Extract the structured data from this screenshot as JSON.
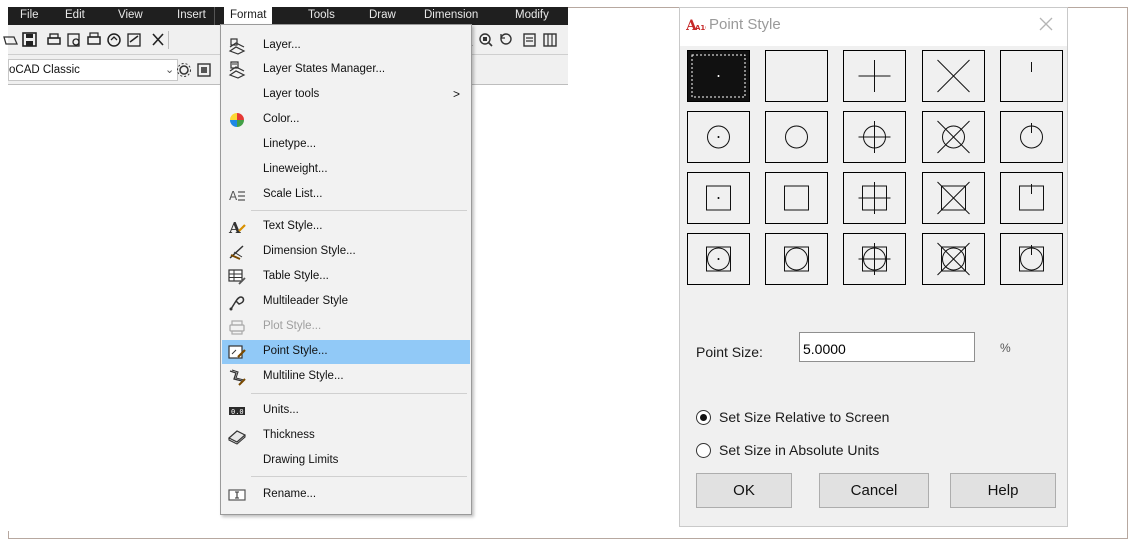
{
  "menubar": {
    "items": [
      "File",
      "Edit",
      "View",
      "Insert",
      "Format",
      "Tools",
      "Draw",
      "Dimension",
      "Modify"
    ],
    "active": "Format"
  },
  "toolbar": {
    "workspace_value": "oCAD Classic"
  },
  "format_menu": {
    "items": [
      {
        "label": "Layer...",
        "icon": "layer-icon"
      },
      {
        "label": "Layer States Manager...",
        "icon": "layer-states-icon"
      },
      {
        "label": "Layer tools",
        "icon": "",
        "submenu": true
      },
      {
        "label": "Color...",
        "icon": "color-wheel-icon"
      },
      {
        "label": "Linetype...",
        "icon": ""
      },
      {
        "label": "Lineweight...",
        "icon": ""
      },
      {
        "label": "Scale List...",
        "icon": "scale-list-icon"
      },
      {
        "label": "Text Style...",
        "icon": "text-style-icon"
      },
      {
        "label": "Dimension Style...",
        "icon": "dimension-style-icon"
      },
      {
        "label": "Table Style...",
        "icon": "table-style-icon"
      },
      {
        "label": "Multileader Style",
        "icon": "multileader-style-icon"
      },
      {
        "label": "Plot Style...",
        "icon": "plot-style-icon",
        "disabled": true
      },
      {
        "label": "Point Style...",
        "icon": "point-style-icon",
        "highlighted": true
      },
      {
        "label": "Multiline Style...",
        "icon": "multiline-style-icon"
      },
      {
        "label": "Units...",
        "icon": "units-icon"
      },
      {
        "label": "Thickness",
        "icon": "thickness-icon"
      },
      {
        "label": "Drawing Limits",
        "icon": ""
      },
      {
        "label": "Rename...",
        "icon": "rename-icon"
      }
    ],
    "submenu_arrow": ">"
  },
  "dialog": {
    "logo_text": "A10",
    "title": "Point Style",
    "point_styles": [
      "dot-selected",
      "none",
      "plus",
      "cross",
      "tick",
      "circle-dot",
      "circle",
      "circle-plus",
      "circle-cross",
      "circle-tick",
      "square-dot",
      "square",
      "square-plus",
      "square-cross",
      "square-tick",
      "circle-square-dot",
      "circle-square",
      "circle-square-plus",
      "circle-square-cross",
      "circle-square-tick"
    ],
    "selected_index": 0,
    "point_size_label": "Point Size:",
    "point_size_value": "5.0000",
    "percent_sign": "%",
    "radio_relative": "Set Size Relative to Screen",
    "radio_absolute": "Set Size in Absolute Units",
    "relative_selected": true,
    "ok_label": "OK",
    "cancel_label": "Cancel",
    "help_label": "Help"
  }
}
